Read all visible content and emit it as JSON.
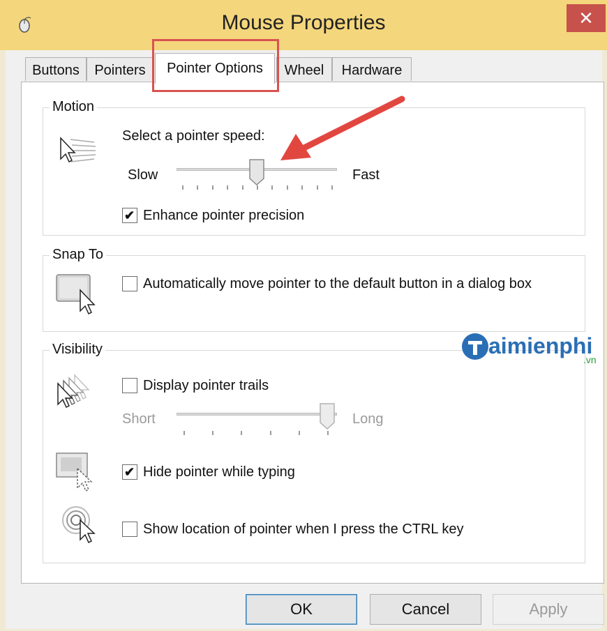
{
  "window": {
    "title": "Mouse Properties",
    "close_glyph": "✕"
  },
  "tabs": [
    {
      "label": "Buttons",
      "active": false
    },
    {
      "label": "Pointers",
      "active": false
    },
    {
      "label": "Pointer Options",
      "active": true
    },
    {
      "label": "Wheel",
      "active": false
    },
    {
      "label": "Hardware",
      "active": false
    }
  ],
  "motion": {
    "group_label": "Motion",
    "speed_label": "Select a pointer speed:",
    "slow_label": "Slow",
    "fast_label": "Fast",
    "speed_value": 6,
    "speed_max": 11,
    "enhance_label": "Enhance pointer precision",
    "enhance_checked": true
  },
  "snap_to": {
    "group_label": "Snap To",
    "auto_move_label": "Automatically move pointer to the default button in a dialog box",
    "auto_move_checked": false
  },
  "visibility": {
    "group_label": "Visibility",
    "trails_label": "Display pointer trails",
    "trails_checked": false,
    "short_label": "Short",
    "long_label": "Long",
    "trails_value": 6,
    "trails_max": 6,
    "hide_label": "Hide pointer while typing",
    "hide_checked": true,
    "ctrl_label": "Show location of pointer when I press the CTRL key",
    "ctrl_checked": false
  },
  "buttons": {
    "ok": "OK",
    "cancel": "Cancel",
    "apply": "Apply"
  },
  "watermark": {
    "brand": "aimienphi",
    "domain": ".vn"
  },
  "colors": {
    "titlebar": "#f4d67c",
    "close": "#c7514b",
    "annotation": "#d9534f",
    "accent": "#2a6fb5"
  }
}
